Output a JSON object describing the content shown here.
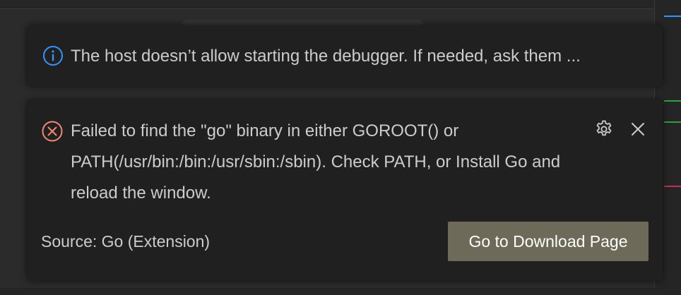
{
  "notifications": {
    "info": {
      "icon": "info-icon",
      "message": "The host doesn’t allow starting the debugger. If needed, ask them ..."
    },
    "error": {
      "icon": "error-icon",
      "message": "Failed to find the \"go\" binary in either GOROOT() or PATH(/usr/bin:/bin:/usr/sbin:/sbin). Check PATH, or Install Go and reload the window.",
      "source": "Source: Go (Extension)",
      "action_label": "Go to Download Page",
      "settings_icon": "gear-icon",
      "close_icon": "close-icon"
    }
  },
  "colors": {
    "toast_background": "#202020",
    "info_accent": "#3794ff",
    "error_accent": "#f48771",
    "button_background": "#6e6a5a",
    "text": "#cccccc"
  }
}
